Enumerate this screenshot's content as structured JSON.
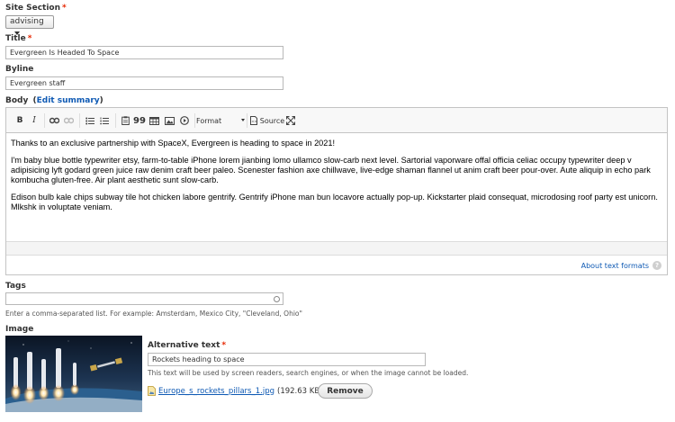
{
  "site_section": {
    "label": "Site Section",
    "required": "*",
    "value": "advising"
  },
  "title_field": {
    "label": "Title",
    "required": "*",
    "value": "Evergreen Is Headed To Space"
  },
  "byline_field": {
    "label": "Byline",
    "value": "Evergreen staff"
  },
  "body_field": {
    "label": "Body",
    "summary_open": "(",
    "summary_link": "Edit summary",
    "summary_close": ")",
    "toolbar": {
      "bold": "B",
      "italic": "I",
      "blockquote": "99",
      "format_label": "Format",
      "source_label": "Source"
    },
    "paragraphs": [
      "Thanks to an exclusive partnership with SpaceX, Evergreen is heading to space in 2021!",
      "I'm baby blue bottle typewriter etsy, farm-to-table iPhone lorem jianbing lomo ullamco slow-carb next level. Sartorial vaporware offal officia celiac occupy typewriter deep v adipisicing lyft godard green juice raw denim craft beer paleo. Scenester fashion axe chillwave, live-edge shaman flannel ut anim craft beer pour-over. Aute aliquip in echo park kombucha gluten-free. Air plant aesthetic sunt slow-carb.",
      "Edison bulb kale chips subway tile hot chicken labore gentrify. Gentrify iPhone man bun locavore actually pop-up. Kickstarter plaid consequat, microdosing roof party est unicorn. Mlkshk in voluptate veniam."
    ],
    "about_formats": "About text formats",
    "help_glyph": "?"
  },
  "tags_field": {
    "label": "Tags",
    "value": "",
    "help": "Enter a comma-separated list. For example: Amsterdam, Mexico City, \"Cleveland, Ohio\""
  },
  "image_field": {
    "label": "Image",
    "alt_label": "Alternative text",
    "required": "*",
    "alt_value": "Rockets heading to space",
    "alt_help": "This text will be used by screen readers, search engines, or when the image cannot be loaded.",
    "file_name": "Europe_s_rockets_pillars_1.jpg",
    "file_size": "(192.63 KB)",
    "remove_label": "Remove"
  },
  "colors": {
    "required": "#e62600",
    "link": "#0f5ab4",
    "border": "#c4c4c4"
  }
}
